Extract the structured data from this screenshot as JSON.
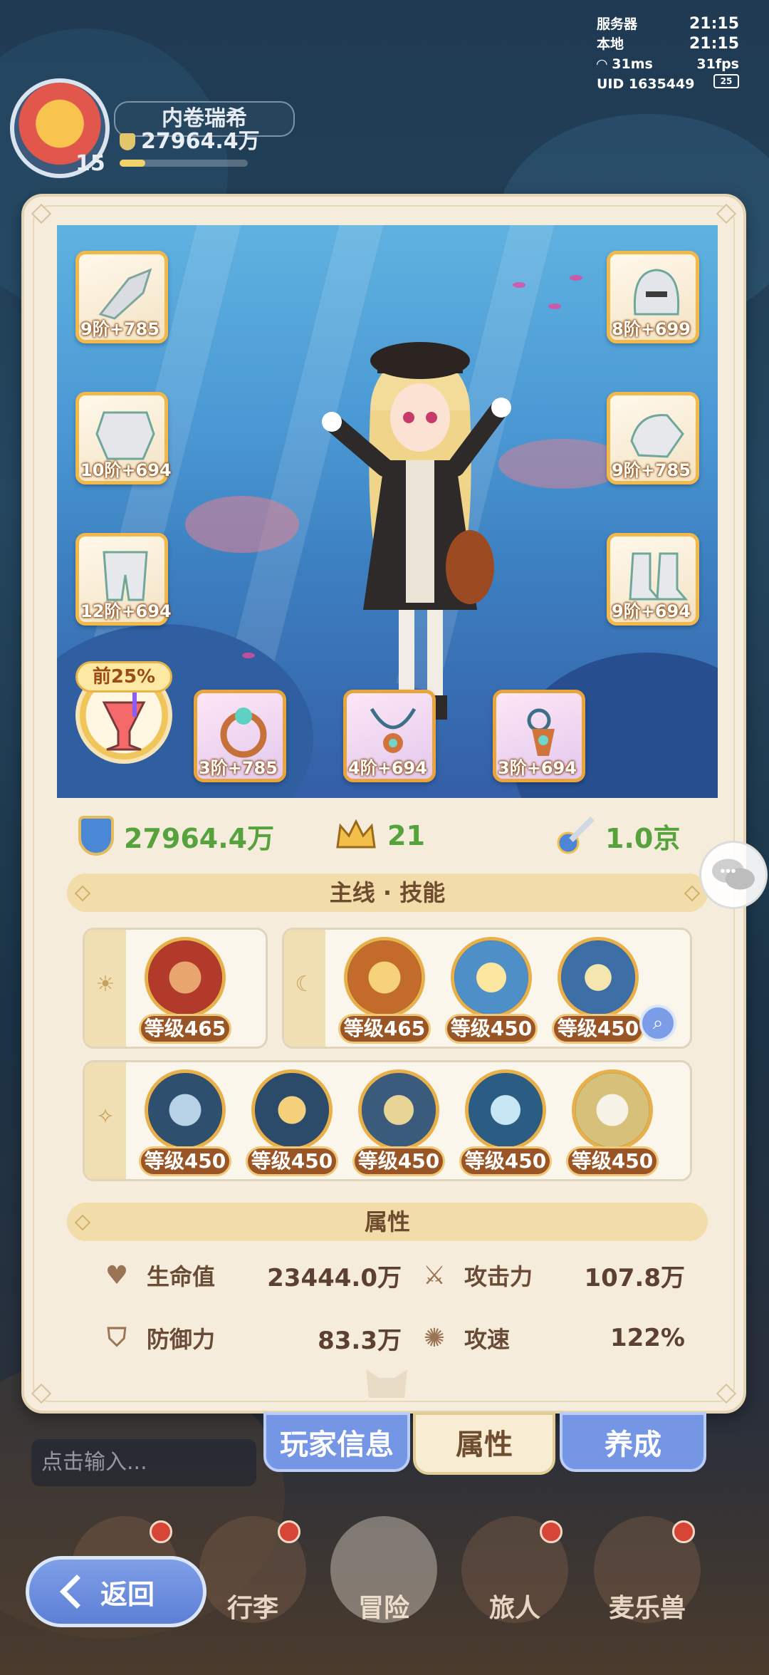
{
  "system": {
    "server_label": "服务器",
    "server_time": "21:15",
    "local_label": "本地",
    "local_time": "21:15",
    "ping": "31ms",
    "fps": "31fps",
    "uid_label": "UID",
    "uid": "1635449",
    "battery": "25"
  },
  "player": {
    "name": "内卷瑞希",
    "power": "27964.4万",
    "level": "15",
    "power_progress": 0.2
  },
  "equipment": {
    "left": [
      {
        "icon": "weapon-gauntlet-icon",
        "tier": "9阶",
        "bonus": "+785"
      },
      {
        "icon": "chest-armor-icon",
        "tier": "10阶",
        "bonus": "+694"
      },
      {
        "icon": "leg-armor-icon",
        "tier": "12阶",
        "bonus": "+694"
      }
    ],
    "right": [
      {
        "icon": "helmet-icon",
        "tier": "8阶",
        "bonus": "+699"
      },
      {
        "icon": "glove-icon",
        "tier": "9阶",
        "bonus": "+785"
      },
      {
        "icon": "boots-icon",
        "tier": "9阶",
        "bonus": "+694"
      }
    ],
    "bottom": [
      {
        "icon": "ring-icon",
        "tier": "3阶",
        "bonus": "+785"
      },
      {
        "icon": "necklace-icon",
        "tier": "4阶",
        "bonus": "+694"
      },
      {
        "icon": "amulet-icon",
        "tier": "3阶",
        "bonus": "+694"
      }
    ],
    "potion": {
      "icon": "potion-icon",
      "tag": "前25%"
    }
  },
  "summary": {
    "power": "27964.4万",
    "crown": "21",
    "dps": "1.0京"
  },
  "skills": {
    "header": "主线 · 技能",
    "day": [
      {
        "icon": "demon-face-icon",
        "level": "等级465"
      }
    ],
    "night": [
      {
        "icon": "whirlwind-icon",
        "level": "等级465"
      },
      {
        "icon": "holy-warrior-icon",
        "level": "等级450"
      },
      {
        "icon": "light-slash-icon",
        "level": "等级450"
      }
    ],
    "star": [
      {
        "icon": "beast-icon",
        "level": "等级450"
      },
      {
        "icon": "meteor-icon",
        "level": "等级450"
      },
      {
        "icon": "shadow-icon",
        "level": "等级450"
      },
      {
        "icon": "ice-blade-icon",
        "level": "等级450"
      },
      {
        "icon": "scroll-icon",
        "level": "等级450"
      }
    ]
  },
  "attributes": {
    "header": "属性",
    "hp_label": "生命值",
    "hp_value": "23444.0万",
    "atk_label": "攻击力",
    "atk_value": "107.8万",
    "def_label": "防御力",
    "def_value": "83.3万",
    "spd_label": "攻速",
    "spd_value": "122%"
  },
  "tabs": {
    "info": "玩家信息",
    "attr": "属性",
    "cultivate": "养成"
  },
  "chat_input": {
    "placeholder": "点击输入..."
  },
  "nav": {
    "luggage": "行李",
    "adventure": "冒险",
    "traveler": "旅人",
    "pet": "麦乐兽"
  },
  "back": "返回",
  "colors": {
    "accent_blue": "#7595e5",
    "gold": "#f2b84a",
    "green_value": "#56a23c",
    "panel": "#f5ecdb"
  }
}
